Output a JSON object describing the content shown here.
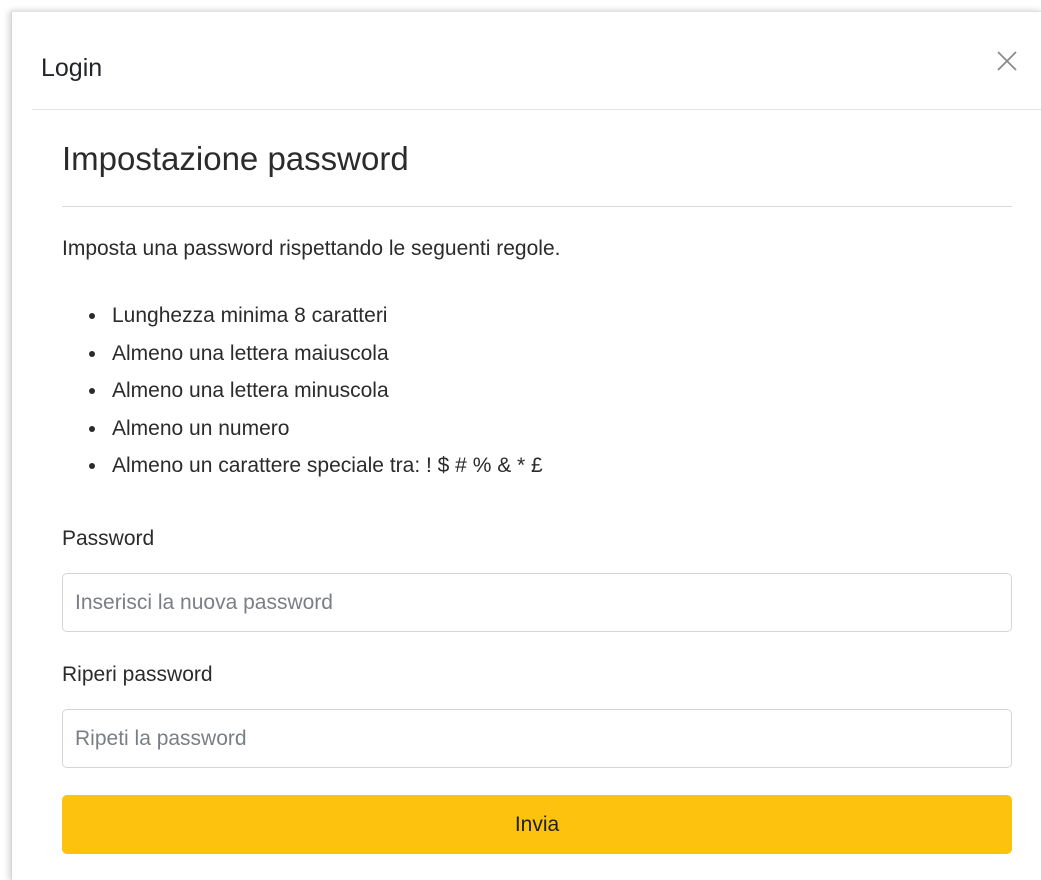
{
  "modal": {
    "title": "Login"
  },
  "form": {
    "heading": "Impostazione password",
    "intro": "Imposta una password rispettando le seguenti regole.",
    "rules": [
      "Lunghezza minima 8 caratteri",
      "Almeno una lettera maiuscola",
      "Almeno una lettera minuscola",
      "Almeno un numero",
      "Almeno un carattere speciale tra: ! $ # % & * £"
    ],
    "password": {
      "label": "Password",
      "value": "",
      "placeholder": "Inserisci la nuova password"
    },
    "repeat_password": {
      "label": "Riperi password",
      "value": "",
      "placeholder": "Ripeti la password"
    },
    "submit_label": "Invia"
  },
  "icons": {
    "close": "close-icon"
  },
  "colors": {
    "accent": "#fdc20e",
    "text": "#2b2b2b",
    "border": "#d3d6d9"
  }
}
